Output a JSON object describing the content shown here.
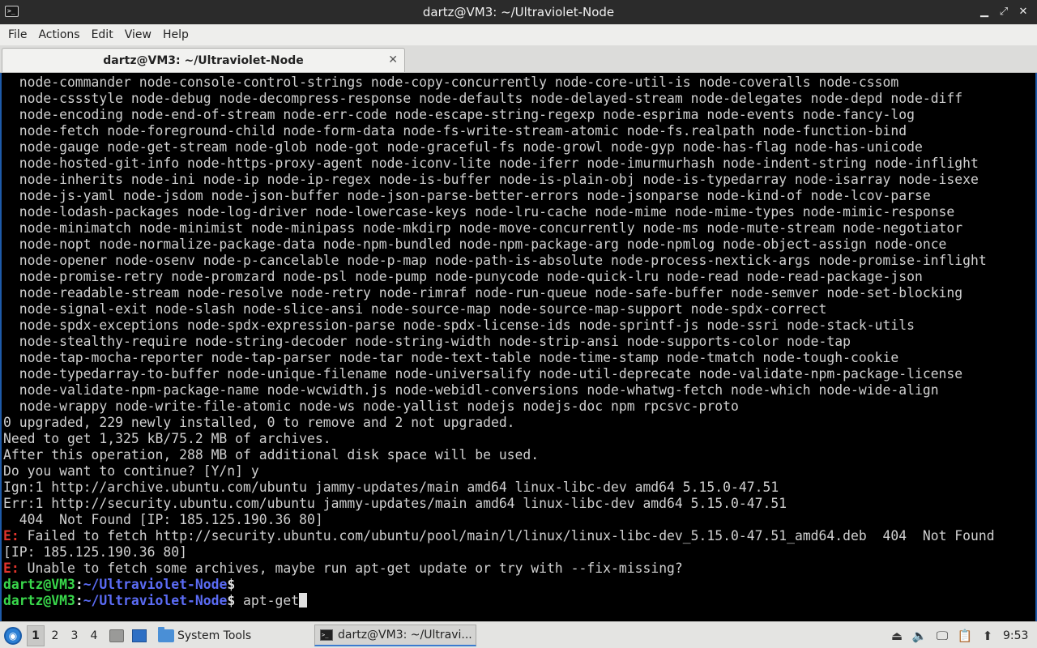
{
  "window": {
    "title": "dartz@VM3: ~/Ultraviolet-Node",
    "controls": {
      "minimize": "▁",
      "maximize": "⤢",
      "close": "✕"
    }
  },
  "menubar": {
    "items": [
      "File",
      "Actions",
      "Edit",
      "View",
      "Help"
    ]
  },
  "tabs": [
    {
      "label": "dartz@VM3: ~/Ultraviolet-Node",
      "close": "✕"
    }
  ],
  "terminal": {
    "lines": [
      {
        "text": "  node-commander node-console-control-strings node-copy-concurrently node-core-util-is node-coveralls node-cssom"
      },
      {
        "text": "  node-cssstyle node-debug node-decompress-response node-defaults node-delayed-stream node-delegates node-depd node-diff"
      },
      {
        "text": "  node-encoding node-end-of-stream node-err-code node-escape-string-regexp node-esprima node-events node-fancy-log"
      },
      {
        "text": "  node-fetch node-foreground-child node-form-data node-fs-write-stream-atomic node-fs.realpath node-function-bind"
      },
      {
        "text": "  node-gauge node-get-stream node-glob node-got node-graceful-fs node-growl node-gyp node-has-flag node-has-unicode"
      },
      {
        "text": "  node-hosted-git-info node-https-proxy-agent node-iconv-lite node-iferr node-imurmurhash node-indent-string node-inflight"
      },
      {
        "text": "  node-inherits node-ini node-ip node-ip-regex node-is-buffer node-is-plain-obj node-is-typedarray node-isarray node-isexe"
      },
      {
        "text": "  node-js-yaml node-jsdom node-json-buffer node-json-parse-better-errors node-jsonparse node-kind-of node-lcov-parse"
      },
      {
        "text": "  node-lodash-packages node-log-driver node-lowercase-keys node-lru-cache node-mime node-mime-types node-mimic-response"
      },
      {
        "text": "  node-minimatch node-minimist node-minipass node-mkdirp node-move-concurrently node-ms node-mute-stream node-negotiator"
      },
      {
        "text": "  node-nopt node-normalize-package-data node-npm-bundled node-npm-package-arg node-npmlog node-object-assign node-once"
      },
      {
        "text": "  node-opener node-osenv node-p-cancelable node-p-map node-path-is-absolute node-process-nextick-args node-promise-inflight"
      },
      {
        "text": "  node-promise-retry node-promzard node-psl node-pump node-punycode node-quick-lru node-read node-read-package-json"
      },
      {
        "text": "  node-readable-stream node-resolve node-retry node-rimraf node-run-queue node-safe-buffer node-semver node-set-blocking"
      },
      {
        "text": "  node-signal-exit node-slash node-slice-ansi node-source-map node-source-map-support node-spdx-correct"
      },
      {
        "text": "  node-spdx-exceptions node-spdx-expression-parse node-spdx-license-ids node-sprintf-js node-ssri node-stack-utils"
      },
      {
        "text": "  node-stealthy-require node-string-decoder node-string-width node-strip-ansi node-supports-color node-tap"
      },
      {
        "text": "  node-tap-mocha-reporter node-tap-parser node-tar node-text-table node-time-stamp node-tmatch node-tough-cookie"
      },
      {
        "text": "  node-typedarray-to-buffer node-unique-filename node-universalify node-util-deprecate node-validate-npm-package-license"
      },
      {
        "text": "  node-validate-npm-package-name node-wcwidth.js node-webidl-conversions node-whatwg-fetch node-which node-wide-align"
      },
      {
        "text": "  node-wrappy node-write-file-atomic node-ws node-yallist nodejs nodejs-doc npm rpcsvc-proto"
      },
      {
        "text": "0 upgraded, 229 newly installed, 0 to remove and 2 not upgraded."
      },
      {
        "text": "Need to get 1,325 kB/75.2 MB of archives."
      },
      {
        "text": "After this operation, 288 MB of additional disk space will be used."
      },
      {
        "text": "Do you want to continue? [Y/n] y"
      },
      {
        "text": "Ign:1 http://archive.ubuntu.com/ubuntu jammy-updates/main amd64 linux-libc-dev amd64 5.15.0-47.51"
      },
      {
        "text": "Err:1 http://security.ubuntu.com/ubuntu jammy-updates/main amd64 linux-libc-dev amd64 5.15.0-47.51"
      },
      {
        "text": "  404  Not Found [IP: 185.125.190.36 80]"
      },
      {
        "prefix": "E:",
        "text": " Failed to fetch http://security.ubuntu.com/ubuntu/pool/main/l/linux/linux-libc-dev_5.15.0-47.51_amd64.deb  404  Not Found"
      },
      {
        "text": "[IP: 185.125.190.36 80]"
      },
      {
        "prefix": "E:",
        "text": " Unable to fetch some archives, maybe run apt-get update or try with --fix-missing?"
      }
    ],
    "prompts": [
      {
        "user": "dartz@VM3",
        "sep": ":",
        "path": "~/Ultraviolet-Node",
        "symbol": "$",
        "command": ""
      },
      {
        "user": "dartz@VM3",
        "sep": ":",
        "path": "~/Ultraviolet-Node",
        "symbol": "$",
        "command": " apt-get"
      }
    ]
  },
  "taskbar": {
    "workspaces": [
      "1",
      "2",
      "3",
      "4"
    ],
    "active_workspace": "1",
    "launchers": [
      {
        "icon": "file-manager-icon"
      },
      {
        "icon": "desktop-icon"
      }
    ],
    "menu_button": {
      "label": "System Tools",
      "icon": "folder-icon"
    },
    "task": {
      "label": "dartz@VM3: ~/Ultravi...",
      "icon": "terminal-icon"
    },
    "tray": [
      "eject-icon",
      "volume-icon",
      "display-icon",
      "clipboard-icon",
      "update-icon"
    ],
    "clock": "9:53"
  }
}
